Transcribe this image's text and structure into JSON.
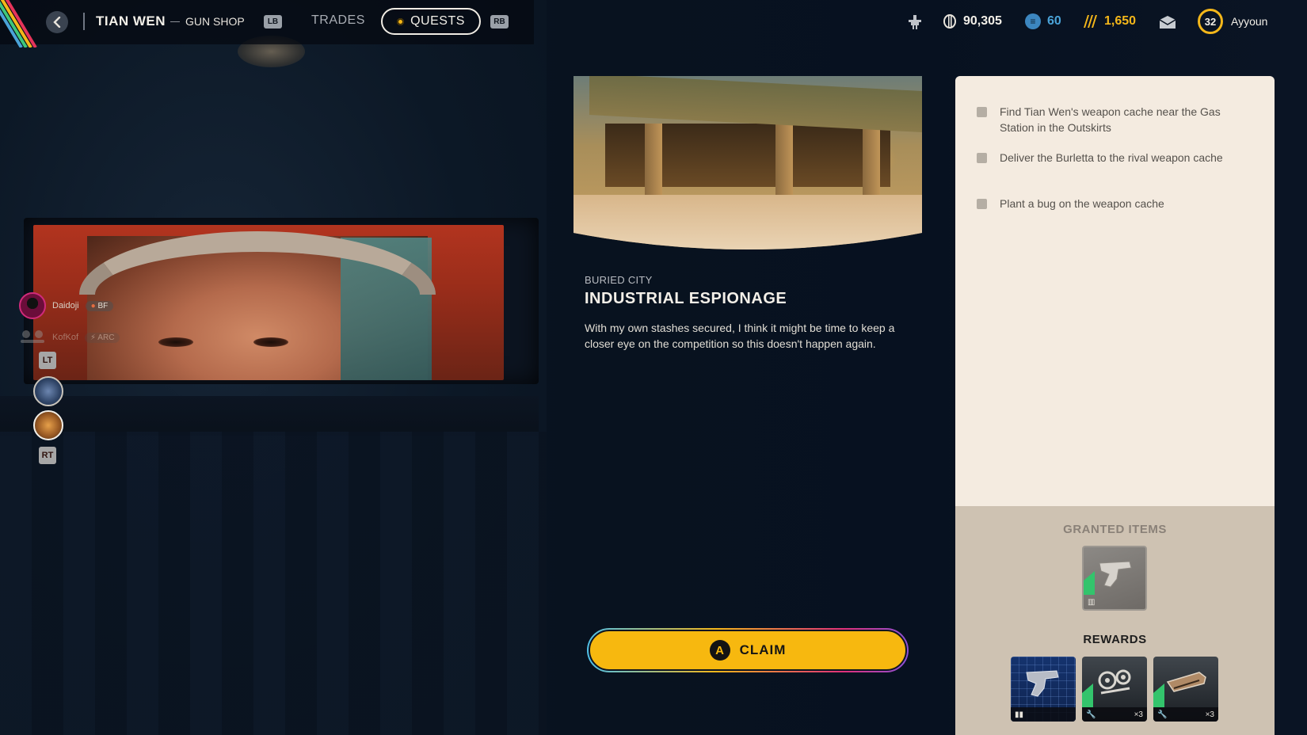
{
  "header": {
    "vendor": "TIAN WEN",
    "shop": "GUN SHOP",
    "lb": "LB",
    "rb": "RB",
    "tabs": [
      {
        "label": "TRADES",
        "active": false
      },
      {
        "label": "QUESTS",
        "active": true
      }
    ],
    "currencies": {
      "coins": "90,305",
      "tokens": "60",
      "premium": "1,650"
    },
    "player": {
      "level": "32",
      "name": "Ayyoun"
    },
    "icons": [
      "back-icon",
      "raider-icon",
      "coin-icon",
      "token-icon",
      "premium-icon",
      "mail-icon"
    ]
  },
  "squad": {
    "members": [
      {
        "name": "Daidoji",
        "tag": "BF"
      },
      {
        "name": "KofKof",
        "tag": "ARC"
      }
    ],
    "lt": "LT",
    "rt": "RT"
  },
  "quest": {
    "location": "BURIED CITY",
    "title": "INDUSTRIAL ESPIONAGE",
    "description": "With my own stashes secured, I think it might be time to keep a closer eye on the competition so this doesn't happen again.",
    "claim_button": "A",
    "claim_label": "CLAIM"
  },
  "objectives": [
    "Find Tian Wen's weapon cache near the Gas Station in the Outskirts",
    "Deliver the Burletta to the rival weapon cache",
    "Plant a bug on the weapon cache"
  ],
  "granted": {
    "title": "GRANTED ITEMS",
    "items": [
      {
        "icon": "pistol-icon"
      }
    ]
  },
  "rewards": {
    "title": "REWARDS",
    "items": [
      {
        "icon": "pistol-blueprint-icon",
        "badge": "blueprint-icon",
        "qty": ""
      },
      {
        "icon": "mechanical-parts-icon",
        "badge": "wrench-icon",
        "qty": "×3"
      },
      {
        "icon": "gun-parts-icon",
        "badge": "wrench-icon",
        "qty": "×3"
      }
    ]
  },
  "colors": {
    "accent": "#f7b80f",
    "panel": "#f4ebe0",
    "panel_bottom": "#cec2b2",
    "token": "#4aa3d8"
  }
}
